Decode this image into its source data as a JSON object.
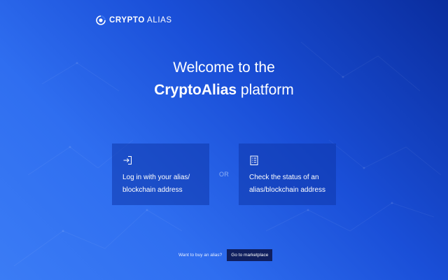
{
  "logo": {
    "brand_bold": "CRYPTO",
    "brand_rest": " ALIAS",
    "icon": "crypto-alias-logo-icon"
  },
  "headline": {
    "line1": "Welcome to the",
    "brand": "CryptoAlias",
    "suffix": " platform"
  },
  "cards": {
    "login": {
      "icon": "login-arrow-icon",
      "label": "Log in with your alias/ blockchain address"
    },
    "status": {
      "icon": "checklist-icon",
      "label": "Check the status of an alias/blockchain address"
    }
  },
  "separator": "OR",
  "marketplace": {
    "question": "Want to buy an alias?",
    "button_label": "Go to marketplace"
  },
  "colors": {
    "background_start": "#3b7cf5",
    "background_end": "#0a2d9e",
    "card": "#1a48b8",
    "button": "#101f5e"
  }
}
